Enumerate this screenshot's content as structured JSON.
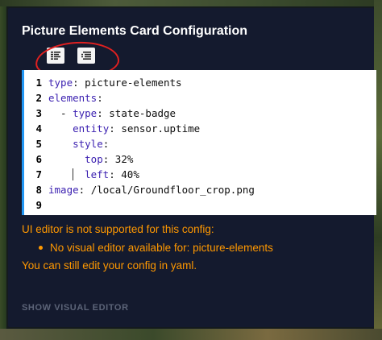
{
  "dialog": {
    "title": "Picture Elements Card Configuration"
  },
  "toolbar": {
    "buttons": [
      {
        "icon": "format-align-icon"
      },
      {
        "icon": "format-indent-icon"
      }
    ]
  },
  "editor": {
    "line_numbers": [
      "1",
      "2",
      "3",
      "4",
      "5",
      "6",
      "7",
      "8",
      "9"
    ],
    "lines": [
      {
        "key": "type",
        "sep": ": ",
        "value": "picture-elements"
      },
      {
        "key": "elements",
        "sep": ":",
        "value": ""
      },
      {
        "key": "type",
        "sep": ": ",
        "value": "state-badge"
      },
      {
        "key": "entity",
        "sep": ": ",
        "value": "sensor.uptime"
      },
      {
        "key": "style",
        "sep": ":",
        "value": ""
      },
      {
        "key": "top",
        "sep": ": ",
        "value": "32%"
      },
      {
        "key": "left",
        "sep": ": ",
        "value": "40%"
      },
      {
        "key": "image",
        "sep": ": ",
        "value": "/local/Groundfloor_crop.png"
      },
      {
        "key": "",
        "sep": "",
        "value": ""
      }
    ]
  },
  "messages": {
    "not_supported": "UI editor is not supported for this config:",
    "bullet": "No visual editor available for: picture-elements",
    "still_edit": "You can still edit your config in yaml."
  },
  "actions": {
    "show_visual_editor": "SHOW VISUAL EDITOR"
  },
  "colors": {
    "dialog_bg": "#141a2e",
    "warning": "#ff9800",
    "editor_accent": "#2196f3",
    "annotation": "#e02020"
  }
}
